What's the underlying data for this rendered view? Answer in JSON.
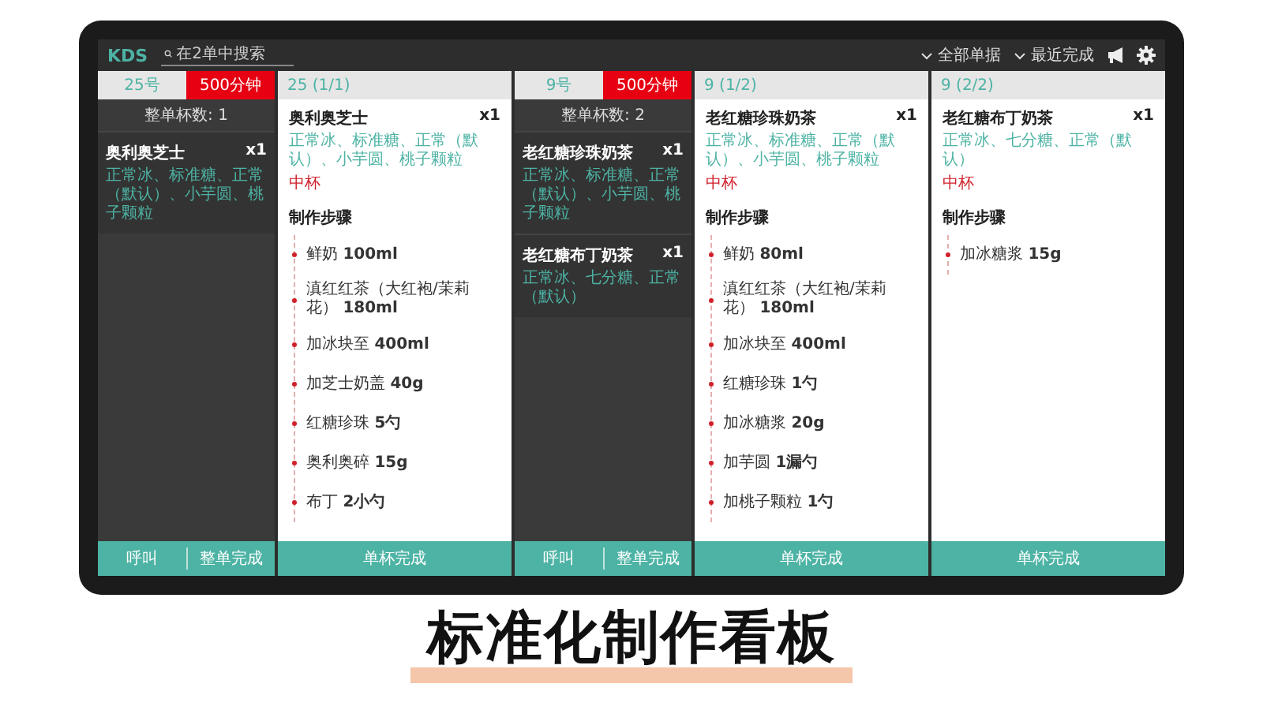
{
  "toolbar": {
    "logo": "KDS",
    "search": {
      "placeholder": "在2单中搜索"
    },
    "filters": [
      "全部单据",
      "最近完成"
    ]
  },
  "orders": [
    {
      "number": "25号",
      "timer": "500分钟",
      "cup_count": "整单杯数: 1",
      "items": [
        {
          "name": "奥利奥芝士",
          "qty": "x1",
          "options": "正常冰、标准糖、正常（默认）、小芋圆、桃子颗粒"
        }
      ],
      "buttons": [
        "呼叫",
        "整单完成"
      ],
      "cups": [
        {
          "header": "25 (1/1)",
          "name": "奥利奥芝士",
          "qty": "x1",
          "options": "正常冰、标准糖、正常（默认）、小芋圆、桃子颗粒",
          "size": "中杯",
          "steps_title": "制作步骤",
          "steps": [
            "鲜奶 **100ml**",
            "滇红红茶（大红袍/茉莉花） **180ml**",
            "加冰块至 **400ml**",
            "加芝士奶盖 **40g**",
            "红糖珍珠 **5勺**",
            "奥利奥碎 **15g**",
            "布丁 **2小勺**"
          ],
          "button": "单杯完成"
        }
      ]
    },
    {
      "number": "9号",
      "timer": "500分钟",
      "cup_count": "整单杯数: 2",
      "items": [
        {
          "name": "老红糖珍珠奶茶",
          "qty": "x1",
          "options": "正常冰、标准糖、正常（默认）、小芋圆、桃子颗粒"
        },
        {
          "name": "老红糖布丁奶茶",
          "qty": "x1",
          "options": "正常冰、七分糖、正常（默认）"
        }
      ],
      "buttons": [
        "呼叫",
        "整单完成"
      ],
      "cups": [
        {
          "header": "9 (1/2)",
          "name": "老红糖珍珠奶茶",
          "qty": "x1",
          "options": "正常冰、标准糖、正常（默认）、小芋圆、桃子颗粒",
          "size": "中杯",
          "steps_title": "制作步骤",
          "steps": [
            "鲜奶 **80ml**",
            "滇红红茶（大红袍/茉莉花） **180ml**",
            "加冰块至 **400ml**",
            "红糖珍珠 **1勺**",
            "加冰糖浆 **20g**",
            "加芋圆 **1漏勺**",
            "加桃子颗粒 **1勺**"
          ],
          "button": "单杯完成"
        },
        {
          "header": "9 (2/2)",
          "name": "老红糖布丁奶茶",
          "qty": "x1",
          "options": "正常冰、七分糖、正常（默认）",
          "size": "中杯",
          "steps_title": "制作步骤",
          "steps": [
            "加冰糖浆 **15g**"
          ],
          "button": "单杯完成"
        }
      ]
    }
  ],
  "caption": "标准化制作看板"
}
